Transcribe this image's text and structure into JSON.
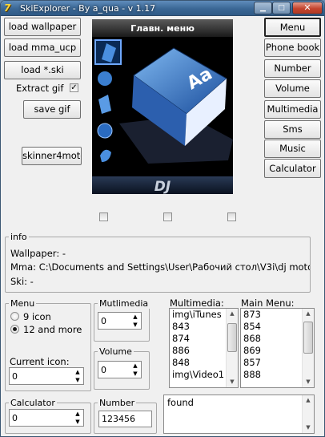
{
  "window": {
    "title": "SkiExplorer - By a_qua - v 1.17",
    "app_icon": "7",
    "min": "▁",
    "max": "□",
    "close": "✕"
  },
  "left_buttons": {
    "load_wallpaper": "load wallpaper",
    "load_mma": "load mma_ucp",
    "load_ski": "load *.ski",
    "extract_gif": "Extract gif",
    "extract_checked": "✓",
    "save_gif": "save gif",
    "skinner": "skinner4moto"
  },
  "preview": {
    "header": "Главн. меню",
    "footer": "DJ"
  },
  "right_buttons": [
    "Menu",
    "Phone book",
    "Number",
    "Volume",
    "Multimedia",
    "Sms",
    "Music",
    "Calculator"
  ],
  "info": {
    "label": "info",
    "wallpaper": "Wallpaper: -",
    "mma": "Mma: C:\\Documents and Settings\\User\\Рабочий стол\\V3i\\dj moto",
    "ski": "Ski: -"
  },
  "menu_group": {
    "label": "Menu",
    "opt1": "9 icon",
    "opt2": "12 and more",
    "current_icon_label": "Current icon:",
    "current_icon": "0"
  },
  "mutlimedia_group": {
    "label": "Mutlimedia",
    "value": "0"
  },
  "volume_group": {
    "label": "Volume",
    "value": "0"
  },
  "multimedia_list": {
    "label": "Multimedia:",
    "items": [
      "img\\iTunes",
      "843",
      "874",
      "886",
      "848",
      "img\\Video1"
    ]
  },
  "main_menu_list": {
    "label": "Main Menu:",
    "items": [
      "873",
      "854",
      "868",
      "869",
      "857",
      "888"
    ]
  },
  "calculator_group": {
    "label": "Calculator",
    "value": "0"
  },
  "number_group": {
    "label": "Number",
    "value": "123456"
  },
  "found_box": {
    "text": "found"
  },
  "icons": {
    "arrow_up": "▲",
    "arrow_down": "▼"
  }
}
